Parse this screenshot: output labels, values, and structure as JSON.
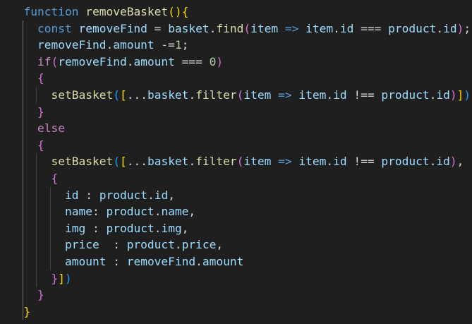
{
  "editor": {
    "theme_colors": {
      "background": "#1f1f1f",
      "keyword": "#569cd6",
      "control": "#c586c0",
      "function": "#dcdcaa",
      "variable": "#9cdcfe",
      "number": "#b5cea8",
      "bracket_level1": "#ffd700",
      "bracket_level2": "#da70d6",
      "bracket_level3": "#179fff"
    },
    "lines": [
      {
        "indent": "  ",
        "tokens": [
          {
            "t": "function",
            "c": "kw"
          },
          {
            "t": " ",
            "c": "op"
          },
          {
            "t": "removeBasket",
            "c": "fn"
          },
          {
            "t": "()",
            "c": "b1"
          },
          {
            "t": "{",
            "c": "b1"
          }
        ]
      },
      {
        "indent": "    ",
        "tokens": [
          {
            "t": "const",
            "c": "kw"
          },
          {
            "t": " ",
            "c": "op"
          },
          {
            "t": "removeFind",
            "c": "var"
          },
          {
            "t": " = ",
            "c": "op"
          },
          {
            "t": "basket",
            "c": "var"
          },
          {
            "t": ".",
            "c": "op"
          },
          {
            "t": "find",
            "c": "fn"
          },
          {
            "t": "(",
            "c": "b2"
          },
          {
            "t": "item",
            "c": "var"
          },
          {
            "t": " ",
            "c": "op"
          },
          {
            "t": "=>",
            "c": "kw"
          },
          {
            "t": " ",
            "c": "op"
          },
          {
            "t": "item",
            "c": "var"
          },
          {
            "t": ".",
            "c": "op"
          },
          {
            "t": "id",
            "c": "var"
          },
          {
            "t": " === ",
            "c": "op"
          },
          {
            "t": "product",
            "c": "var"
          },
          {
            "t": ".",
            "c": "op"
          },
          {
            "t": "id",
            "c": "var"
          },
          {
            "t": ")",
            "c": "b2"
          },
          {
            "t": ";",
            "c": "op"
          }
        ]
      },
      {
        "indent": "    ",
        "tokens": [
          {
            "t": "removeFind",
            "c": "var"
          },
          {
            "t": ".",
            "c": "op"
          },
          {
            "t": "amount",
            "c": "var"
          },
          {
            "t": " -=",
            "c": "op"
          },
          {
            "t": "1",
            "c": "num"
          },
          {
            "t": ";",
            "c": "op"
          }
        ]
      },
      {
        "indent": "    ",
        "tokens": [
          {
            "t": "if",
            "c": "ctrl"
          },
          {
            "t": "(",
            "c": "b2"
          },
          {
            "t": "removeFind",
            "c": "var"
          },
          {
            "t": ".",
            "c": "op"
          },
          {
            "t": "amount",
            "c": "var"
          },
          {
            "t": " === ",
            "c": "op"
          },
          {
            "t": "0",
            "c": "num"
          },
          {
            "t": ")",
            "c": "b2"
          }
        ]
      },
      {
        "indent": "    ",
        "tokens": [
          {
            "t": "{",
            "c": "b2"
          }
        ]
      },
      {
        "indent": "      ",
        "tokens": [
          {
            "t": "setBasket",
            "c": "fn"
          },
          {
            "t": "(",
            "c": "b3"
          },
          {
            "t": "[",
            "c": "b1"
          },
          {
            "t": "...",
            "c": "op"
          },
          {
            "t": "basket",
            "c": "var"
          },
          {
            "t": ".",
            "c": "op"
          },
          {
            "t": "filter",
            "c": "fn"
          },
          {
            "t": "(",
            "c": "b2"
          },
          {
            "t": "item",
            "c": "var"
          },
          {
            "t": " ",
            "c": "op"
          },
          {
            "t": "=>",
            "c": "kw"
          },
          {
            "t": " ",
            "c": "op"
          },
          {
            "t": "item",
            "c": "var"
          },
          {
            "t": ".",
            "c": "op"
          },
          {
            "t": "id",
            "c": "var"
          },
          {
            "t": " !== ",
            "c": "op"
          },
          {
            "t": "product",
            "c": "var"
          },
          {
            "t": ".",
            "c": "op"
          },
          {
            "t": "id",
            "c": "var"
          },
          {
            "t": ")",
            "c": "b2"
          },
          {
            "t": "]",
            "c": "b1"
          },
          {
            "t": ")",
            "c": "b3"
          },
          {
            "t": ";",
            "c": "op"
          }
        ]
      },
      {
        "indent": "    ",
        "tokens": [
          {
            "t": "}",
            "c": "b2"
          }
        ]
      },
      {
        "indent": "    ",
        "tokens": [
          {
            "t": "else",
            "c": "ctrl"
          }
        ]
      },
      {
        "indent": "    ",
        "tokens": [
          {
            "t": "{",
            "c": "b2"
          }
        ]
      },
      {
        "indent": "      ",
        "tokens": [
          {
            "t": "setBasket",
            "c": "fn"
          },
          {
            "t": "(",
            "c": "b3"
          },
          {
            "t": "[",
            "c": "b1"
          },
          {
            "t": "...",
            "c": "op"
          },
          {
            "t": "basket",
            "c": "var"
          },
          {
            "t": ".",
            "c": "op"
          },
          {
            "t": "filter",
            "c": "fn"
          },
          {
            "t": "(",
            "c": "b2"
          },
          {
            "t": "item",
            "c": "var"
          },
          {
            "t": " ",
            "c": "op"
          },
          {
            "t": "=>",
            "c": "kw"
          },
          {
            "t": " ",
            "c": "op"
          },
          {
            "t": "item",
            "c": "var"
          },
          {
            "t": ".",
            "c": "op"
          },
          {
            "t": "id",
            "c": "var"
          },
          {
            "t": " !== ",
            "c": "op"
          },
          {
            "t": "product",
            "c": "var"
          },
          {
            "t": ".",
            "c": "op"
          },
          {
            "t": "id",
            "c": "var"
          },
          {
            "t": ")",
            "c": "b2"
          },
          {
            "t": ",",
            "c": "op"
          }
        ]
      },
      {
        "indent": "      ",
        "tokens": [
          {
            "t": "{",
            "c": "b2"
          }
        ]
      },
      {
        "indent": "        ",
        "tokens": [
          {
            "t": "id",
            "c": "var"
          },
          {
            "t": " : ",
            "c": "op"
          },
          {
            "t": "product",
            "c": "var"
          },
          {
            "t": ".",
            "c": "op"
          },
          {
            "t": "id",
            "c": "var"
          },
          {
            "t": ",",
            "c": "op"
          }
        ]
      },
      {
        "indent": "        ",
        "tokens": [
          {
            "t": "name",
            "c": "var"
          },
          {
            "t": ": ",
            "c": "op"
          },
          {
            "t": "product",
            "c": "var"
          },
          {
            "t": ".",
            "c": "op"
          },
          {
            "t": "name",
            "c": "var"
          },
          {
            "t": ",",
            "c": "op"
          }
        ]
      },
      {
        "indent": "        ",
        "tokens": [
          {
            "t": "img",
            "c": "var"
          },
          {
            "t": " : ",
            "c": "op"
          },
          {
            "t": "product",
            "c": "var"
          },
          {
            "t": ".",
            "c": "op"
          },
          {
            "t": "img",
            "c": "var"
          },
          {
            "t": ",",
            "c": "op"
          }
        ]
      },
      {
        "indent": "        ",
        "tokens": [
          {
            "t": "price",
            "c": "var"
          },
          {
            "t": "  : ",
            "c": "op"
          },
          {
            "t": "product",
            "c": "var"
          },
          {
            "t": ".",
            "c": "op"
          },
          {
            "t": "price",
            "c": "var"
          },
          {
            "t": ",",
            "c": "op"
          }
        ]
      },
      {
        "indent": "        ",
        "tokens": [
          {
            "t": "amount",
            "c": "var"
          },
          {
            "t": " : ",
            "c": "op"
          },
          {
            "t": "removeFind",
            "c": "var"
          },
          {
            "t": ".",
            "c": "op"
          },
          {
            "t": "amount",
            "c": "var"
          }
        ]
      },
      {
        "indent": "      ",
        "tokens": [
          {
            "t": "}",
            "c": "b2"
          },
          {
            "t": "]",
            "c": "b1"
          },
          {
            "t": ")",
            "c": "b3"
          }
        ]
      },
      {
        "indent": "    ",
        "tokens": [
          {
            "t": "}",
            "c": "b2"
          }
        ]
      },
      {
        "indent": "  ",
        "tokens": [
          {
            "t": "}",
            "c": "b1"
          }
        ]
      }
    ]
  }
}
